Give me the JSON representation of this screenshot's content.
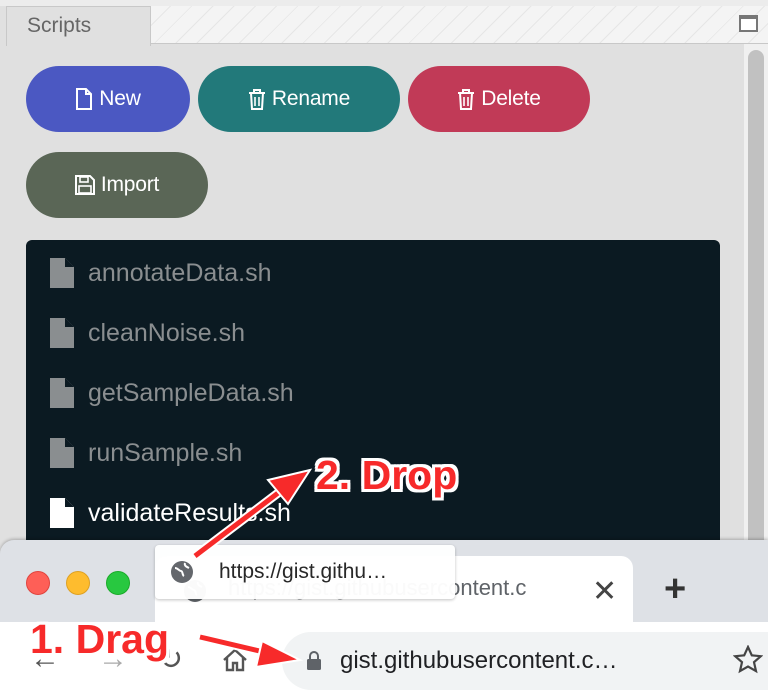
{
  "panel": {
    "tab_label": "Scripts",
    "buttons": {
      "new": "New",
      "rename": "Rename",
      "delete": "Delete",
      "import": "Import"
    },
    "files": [
      {
        "name": "annotateData.sh"
      },
      {
        "name": "cleanNoise.sh"
      },
      {
        "name": "getSampleData.sh"
      },
      {
        "name": "runSample.sh"
      },
      {
        "name": "validateResults.sh",
        "active": true
      }
    ],
    "colors": {
      "new": "#4b58c2",
      "rename": "#22797a",
      "delete": "#c13a57",
      "import": "#5a6656",
      "file_list_bg": "#0b1a22"
    }
  },
  "browser": {
    "tab_title": "https://gist.githubusercontent.c",
    "drag_preview_url": "https://gist.githu…",
    "address": "gist.githubusercontent.c…"
  },
  "annotations": {
    "drop": "2. Drop",
    "drag": "1. Drag",
    "color": "#f72a2a"
  }
}
